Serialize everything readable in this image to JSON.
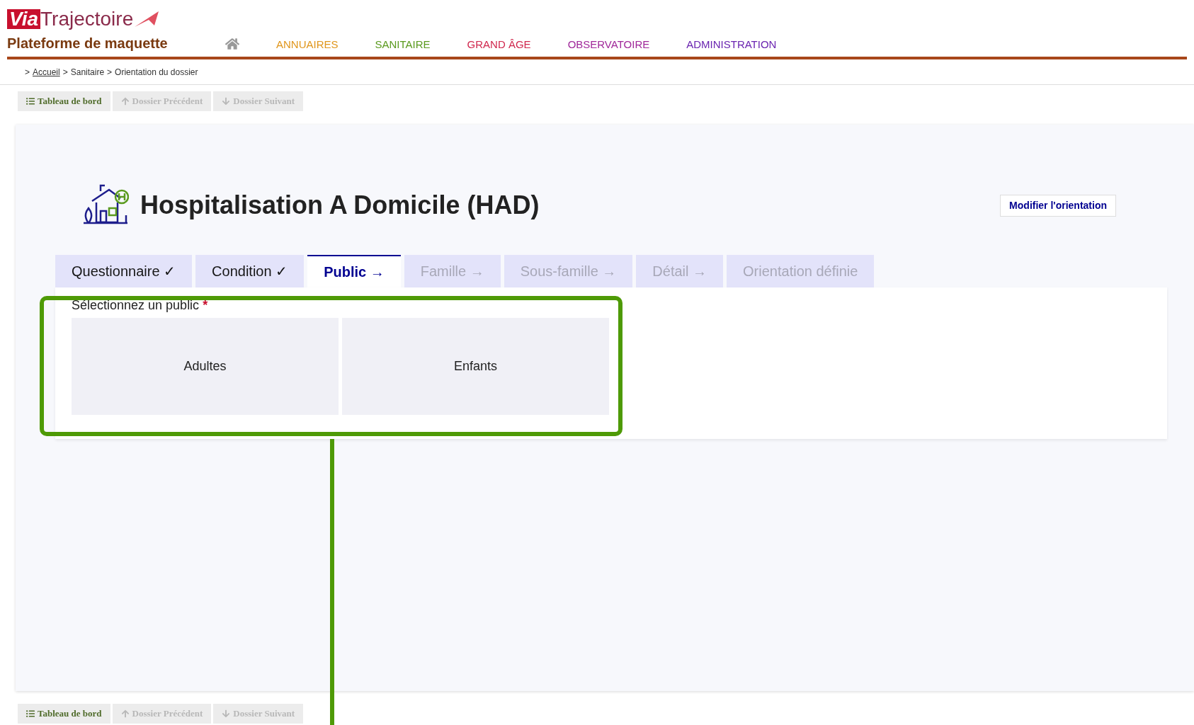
{
  "header": {
    "logo_prefix": "Via",
    "logo_name": "Trajectoire",
    "platform": "Plateforme de maquette",
    "nav": [
      {
        "label": "ANNUAIRES",
        "color": "#e0961c"
      },
      {
        "label": "SANITAIRE",
        "color": "#5a9a1e"
      },
      {
        "label": "GRAND ÂGE",
        "color": "#d0284e"
      },
      {
        "label": "OBSERVATOIRE",
        "color": "#a0289a"
      },
      {
        "label": "ADMINISTRATION",
        "color": "#6a24b0"
      }
    ]
  },
  "breadcrumb": {
    "prefix": ">",
    "items": [
      {
        "label": "Accueil",
        "link": true
      },
      {
        "label": "Sanitaire",
        "link": false
      },
      {
        "label": "Orientation du dossier",
        "link": false
      }
    ],
    "separator": ">"
  },
  "toolbar_top": [
    {
      "kind": "dashboard",
      "label": "Tableau de bord",
      "disabled": false
    },
    {
      "kind": "up",
      "label": "Dossier Précédent",
      "disabled": true
    },
    {
      "kind": "down",
      "label": "Dossier Suivant",
      "disabled": true
    }
  ],
  "page": {
    "title": "Hospitalisation A Domicile (HAD)",
    "action": "Modifier l'orientation"
  },
  "steps": [
    {
      "label": "Questionnaire ✓",
      "selected": false,
      "disabled": false
    },
    {
      "label": "Condition ✓",
      "selected": false,
      "disabled": false
    },
    {
      "label": "Public →",
      "selected": true,
      "disabled": false
    },
    {
      "label": "Famille →",
      "selected": false,
      "disabled": true
    },
    {
      "label": "Sous-famille →",
      "selected": false,
      "disabled": true
    },
    {
      "label": "Détail →",
      "selected": false,
      "disabled": true
    },
    {
      "label": "Orientation définie",
      "selected": false,
      "disabled": true
    }
  ],
  "question": {
    "label": "Sélectionnez un public",
    "required_mark": "*",
    "options": [
      {
        "label": "Adultes"
      },
      {
        "label": "Enfants"
      }
    ]
  },
  "toolbar_bottom": [
    {
      "kind": "dashboard",
      "label": "Tableau de bord",
      "disabled": false
    },
    {
      "kind": "up",
      "label": "Dossier Précédent",
      "disabled": true
    },
    {
      "kind": "down",
      "label": "Dossier Suivant",
      "disabled": true
    }
  ]
}
